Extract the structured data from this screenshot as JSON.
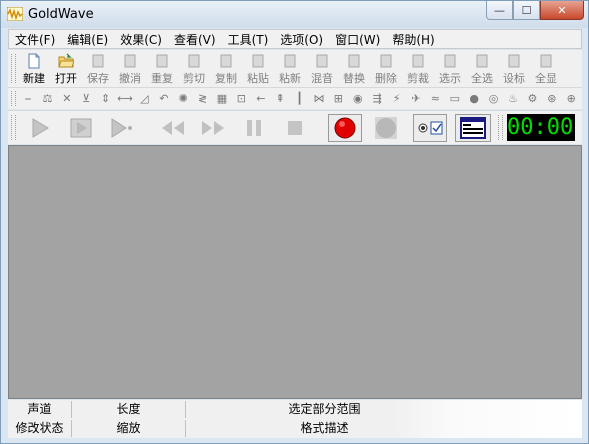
{
  "window": {
    "title": "GoldWave",
    "buttons": {
      "minimize": "—",
      "maximize": "☐",
      "close": "✕"
    }
  },
  "menu": [
    "文件(F)",
    "编辑(E)",
    "效果(C)",
    "查看(V)",
    "工具(T)",
    "选项(O)",
    "窗口(W)",
    "帮助(H)"
  ],
  "toolbar_main": [
    {
      "label": "新建",
      "icon": "new-file-icon",
      "enabled": true
    },
    {
      "label": "打开",
      "icon": "open-folder-icon",
      "enabled": true
    },
    {
      "label": "保存",
      "icon": "save-icon",
      "enabled": false
    },
    {
      "label": "撤消",
      "icon": "undo-icon",
      "enabled": false
    },
    {
      "label": "重复",
      "icon": "redo-icon",
      "enabled": false
    },
    {
      "label": "剪切",
      "icon": "cut-icon",
      "enabled": false
    },
    {
      "label": "复制",
      "icon": "copy-icon",
      "enabled": false
    },
    {
      "label": "粘贴",
      "icon": "paste-icon",
      "enabled": false
    },
    {
      "label": "粘新",
      "icon": "paste-new-icon",
      "enabled": false
    },
    {
      "label": "混音",
      "icon": "mix-icon",
      "enabled": false
    },
    {
      "label": "替换",
      "icon": "replace-icon",
      "enabled": false
    },
    {
      "label": "删除",
      "icon": "delete-icon",
      "enabled": false
    },
    {
      "label": "剪裁",
      "icon": "trim-icon",
      "enabled": false
    },
    {
      "label": "选示",
      "icon": "select-view-icon",
      "enabled": false
    },
    {
      "label": "全选",
      "icon": "select-all-icon",
      "enabled": false
    },
    {
      "label": "设标",
      "icon": "set-marker-icon",
      "enabled": false
    },
    {
      "label": "全显",
      "icon": "zoom-all-icon",
      "enabled": false
    }
  ],
  "toolbar_effects_count": 29,
  "time_display": "00:00:",
  "status": {
    "row1": [
      "声道",
      "长度",
      "选定部分范围"
    ],
    "row2": [
      "修改状态",
      "缩放",
      "格式描述"
    ]
  },
  "colors": {
    "workarea": "#a3a3a3",
    "time_text": "#00e000",
    "record": "#e00000"
  }
}
